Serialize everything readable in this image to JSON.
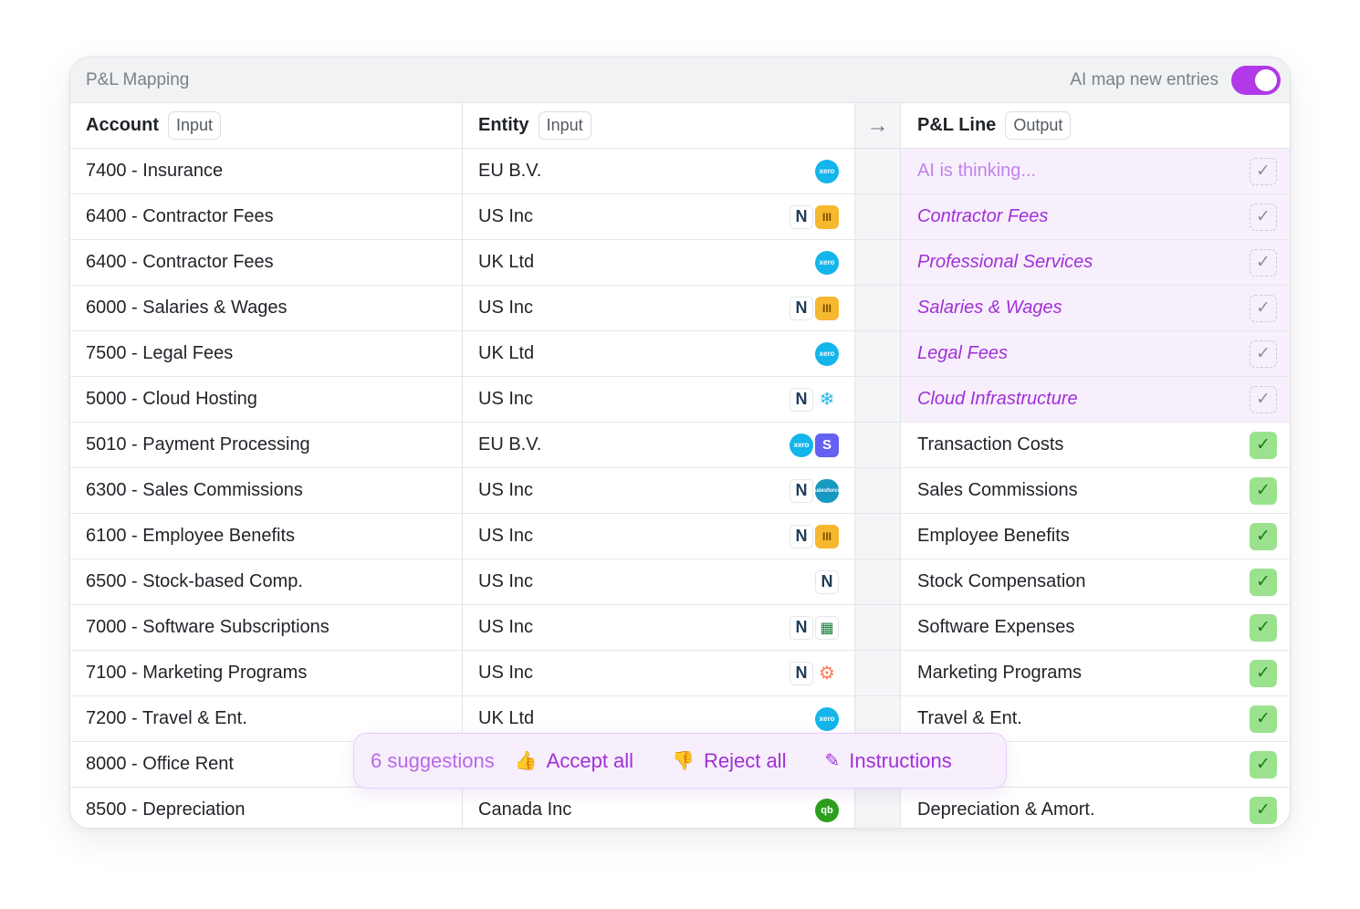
{
  "header": {
    "title": "P&L Mapping",
    "toggle_label": "AI map new entries",
    "toggle_on": true,
    "accent_color": "#b139e8"
  },
  "columns": [
    {
      "label": "Account",
      "tag": "Input"
    },
    {
      "label": "Entity",
      "tag": "Input"
    },
    {
      "arrow": "→"
    },
    {
      "label": "P&L Line",
      "tag": "Output"
    }
  ],
  "rows": [
    {
      "account": "7400 - Insurance",
      "entity": "EU B.V.",
      "icons": [
        "xero"
      ],
      "pl_line": "AI is thinking...",
      "state": "thinking"
    },
    {
      "account": "6400 - Contractor Fees",
      "entity": "US Inc",
      "icons": [
        "netsuite",
        "rippling"
      ],
      "pl_line": "Contractor Fees",
      "state": "suggested"
    },
    {
      "account": "6400 - Contractor Fees",
      "entity": "UK Ltd",
      "icons": [
        "xero"
      ],
      "pl_line": "Professional Services",
      "state": "suggested"
    },
    {
      "account": "6000 - Salaries & Wages",
      "entity": "US Inc",
      "icons": [
        "netsuite",
        "rippling"
      ],
      "pl_line": "Salaries & Wages",
      "state": "suggested"
    },
    {
      "account": "7500 - Legal Fees",
      "entity": "UK Ltd",
      "icons": [
        "xero"
      ],
      "pl_line": "Legal Fees",
      "state": "suggested"
    },
    {
      "account": "5000 - Cloud Hosting",
      "entity": "US Inc",
      "icons": [
        "netsuite",
        "snowflake"
      ],
      "pl_line": "Cloud Infrastructure",
      "state": "suggested"
    },
    {
      "account": "5010 - Payment Processing",
      "entity": "EU B.V.",
      "icons": [
        "xero",
        "stripe"
      ],
      "pl_line": "Transaction Costs",
      "state": "approved"
    },
    {
      "account": "6300 - Sales Commissions",
      "entity": "US Inc",
      "icons": [
        "netsuite",
        "salesforce"
      ],
      "pl_line": "Sales Commissions",
      "state": "approved"
    },
    {
      "account": "6100 - Employee Benefits",
      "entity": "US Inc",
      "icons": [
        "netsuite",
        "rippling"
      ],
      "pl_line": "Employee Benefits",
      "state": "approved"
    },
    {
      "account": "6500 - Stock-based Comp.",
      "entity": "US Inc",
      "icons": [
        "netsuite"
      ],
      "pl_line": "Stock Compensation",
      "state": "approved"
    },
    {
      "account": "7000 - Software Subscriptions",
      "entity": "US Inc",
      "icons": [
        "netsuite",
        "google-sheets"
      ],
      "pl_line": "Software Expenses",
      "state": "approved"
    },
    {
      "account": "7100 - Marketing Programs",
      "entity": "US Inc",
      "icons": [
        "netsuite",
        "hubspot"
      ],
      "pl_line": "Marketing Programs",
      "state": "approved"
    },
    {
      "account": "7200 - Travel & Ent.",
      "entity": "UK Ltd",
      "icons": [
        "xero"
      ],
      "pl_line": "Travel & Ent.",
      "state": "approved"
    },
    {
      "account": "8000 - Office Rent",
      "entity": "",
      "icons": [],
      "pl_line": "t",
      "state": "approved"
    },
    {
      "account": "8500 - Depreciation",
      "entity": "Canada Inc",
      "icons": [
        "quickbooks"
      ],
      "pl_line": "Depreciation & Amort.",
      "state": "approved"
    }
  ],
  "icon_labels": {
    "xero": "xero",
    "netsuite": "N",
    "rippling": "III",
    "snowflake": "❄",
    "stripe": "S",
    "salesforce": "salesforce",
    "google-sheets": "▦",
    "hubspot": "⚙",
    "quickbooks": "qb"
  },
  "suggestion_bar": {
    "count_label": "6 suggestions",
    "accept_label": "Accept all",
    "accept_icon": "👍",
    "reject_label": "Reject all",
    "reject_icon": "👎",
    "instructions_label": "Instructions",
    "instructions_icon": "✎"
  },
  "check_glyph": "✓"
}
